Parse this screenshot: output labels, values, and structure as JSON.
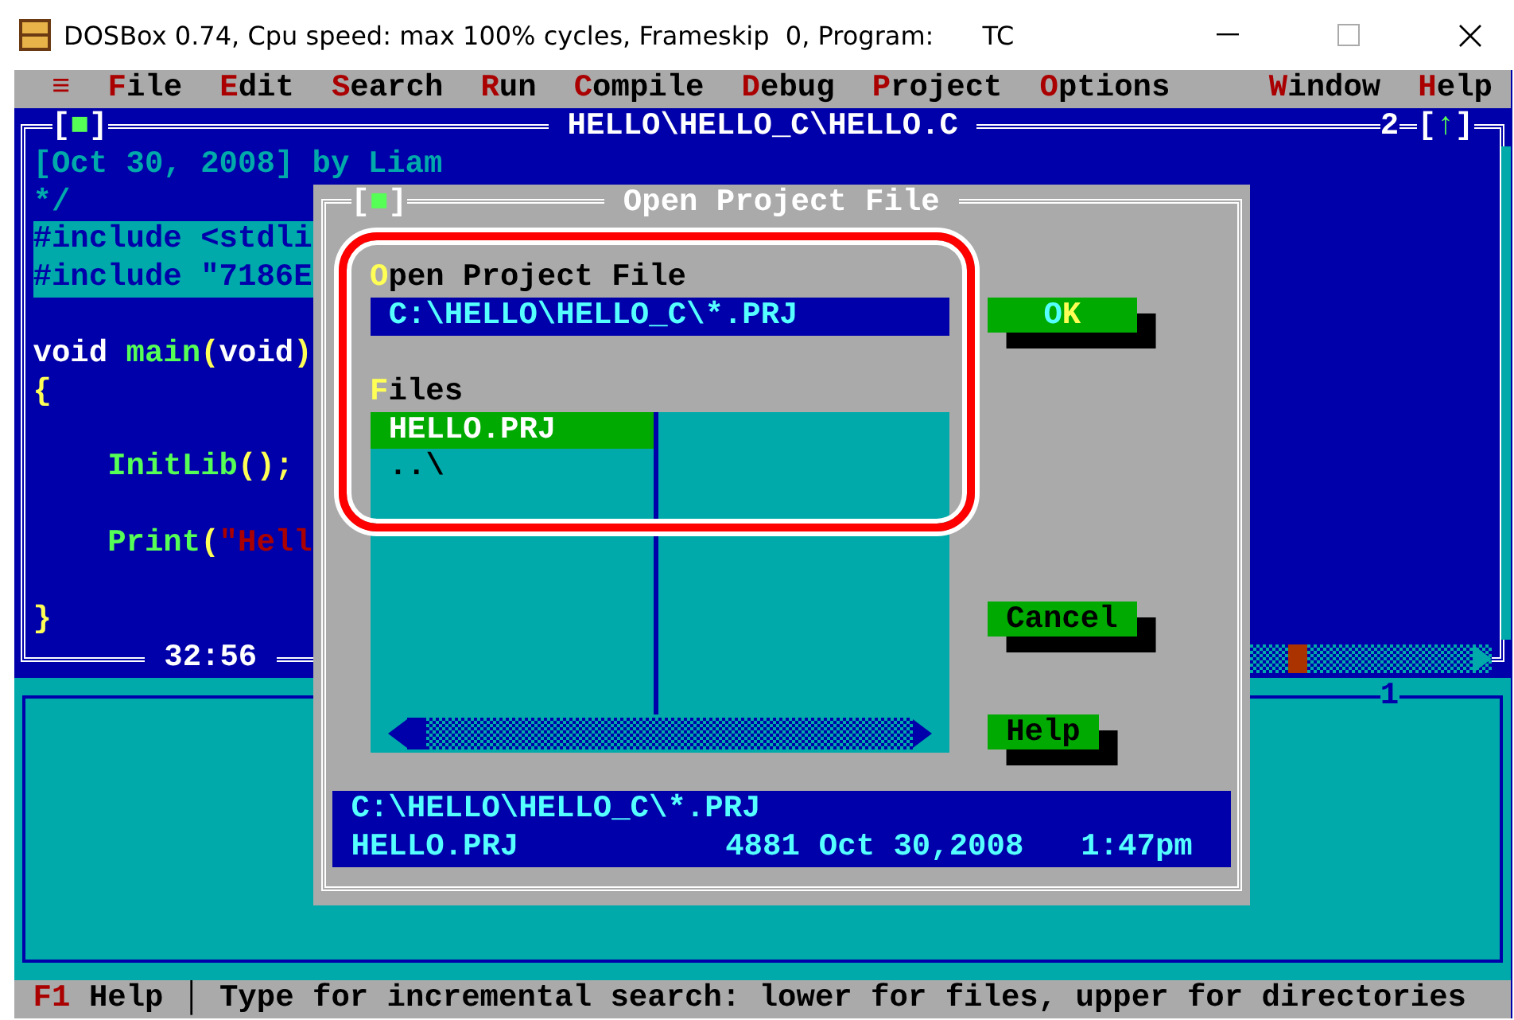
{
  "window": {
    "title": "DOSBox 0.74, Cpu speed: max 100% cycles, Frameskip  0, Program:      TC"
  },
  "menu": {
    "system": "≡",
    "items": [
      "File",
      "Edit",
      "Search",
      "Run",
      "Compile",
      "Debug",
      "Project",
      "Options"
    ],
    "right_items": [
      "Window",
      "Help"
    ]
  },
  "editor": {
    "close_box": "[■]",
    "title": "HELLO\\HELLO_C\\HELLO.C",
    "window_number": "2",
    "zoom_box": "[↑]",
    "cursor": "32:56",
    "lines": [
      {
        "kind": "code",
        "selected": false,
        "tokens": [
          {
            "kind": "comment",
            "text": "[Oct 30, 2008] by Liam"
          }
        ]
      },
      {
        "kind": "code",
        "selected": false,
        "tokens": [
          {
            "kind": "comment",
            "text": "*/"
          }
        ]
      },
      {
        "kind": "code",
        "selected": true,
        "tokens": [
          {
            "kind": "preproc",
            "text": "#include <stdli"
          }
        ]
      },
      {
        "kind": "code",
        "selected": true,
        "tokens": [
          {
            "kind": "preproc",
            "text": "#include \"7186E"
          }
        ]
      },
      {
        "kind": "blank"
      },
      {
        "kind": "code",
        "selected": false,
        "tokens": [
          {
            "kind": "keyword",
            "text": "void "
          },
          {
            "kind": "ident",
            "text": "main"
          },
          {
            "kind": "symbol",
            "text": "("
          },
          {
            "kind": "keyword",
            "text": "void"
          },
          {
            "kind": "symbol",
            "text": ")"
          }
        ]
      },
      {
        "kind": "code",
        "selected": false,
        "tokens": [
          {
            "kind": "symbol",
            "text": "{"
          }
        ]
      },
      {
        "kind": "blank"
      },
      {
        "kind": "code",
        "selected": false,
        "tokens": [
          {
            "kind": "ident",
            "text": "    InitLib"
          },
          {
            "kind": "symbol",
            "text": "();"
          }
        ]
      },
      {
        "kind": "blank"
      },
      {
        "kind": "code",
        "selected": false,
        "tokens": [
          {
            "kind": "ident",
            "text": "    Print"
          },
          {
            "kind": "symbol",
            "text": "("
          },
          {
            "kind": "string",
            "text": "\"Hell"
          }
        ]
      },
      {
        "kind": "blank"
      },
      {
        "kind": "code",
        "selected": false,
        "tokens": [
          {
            "kind": "symbol",
            "text": "}"
          }
        ]
      }
    ]
  },
  "dialog": {
    "close_box": "[■]",
    "title": "Open Project File",
    "field_label": "Open Project File",
    "field_value": "C:\\HELLO\\HELLO_C\\*.PRJ",
    "files_label": "Files",
    "files": [
      {
        "name": "HELLO.PRJ",
        "selected": true
      },
      {
        "name": "..\\",
        "selected": false
      }
    ],
    "buttons": [
      {
        "label": "OK",
        "default": true
      },
      {
        "label": "Cancel",
        "default": false
      },
      {
        "label": "Help",
        "default": false
      }
    ],
    "info": {
      "path": "C:\\HELLO\\HELLO_C\\*.PRJ",
      "name": "HELLO.PRJ",
      "size": "4881",
      "date": "Oct 30,2008",
      "time": "1:47pm"
    }
  },
  "message_window": {
    "number": "1"
  },
  "status_bar": {
    "key": "F1",
    "key_label": "Help",
    "separator": "│",
    "hint": "Type for incremental search: lower for files, upper for directories"
  }
}
